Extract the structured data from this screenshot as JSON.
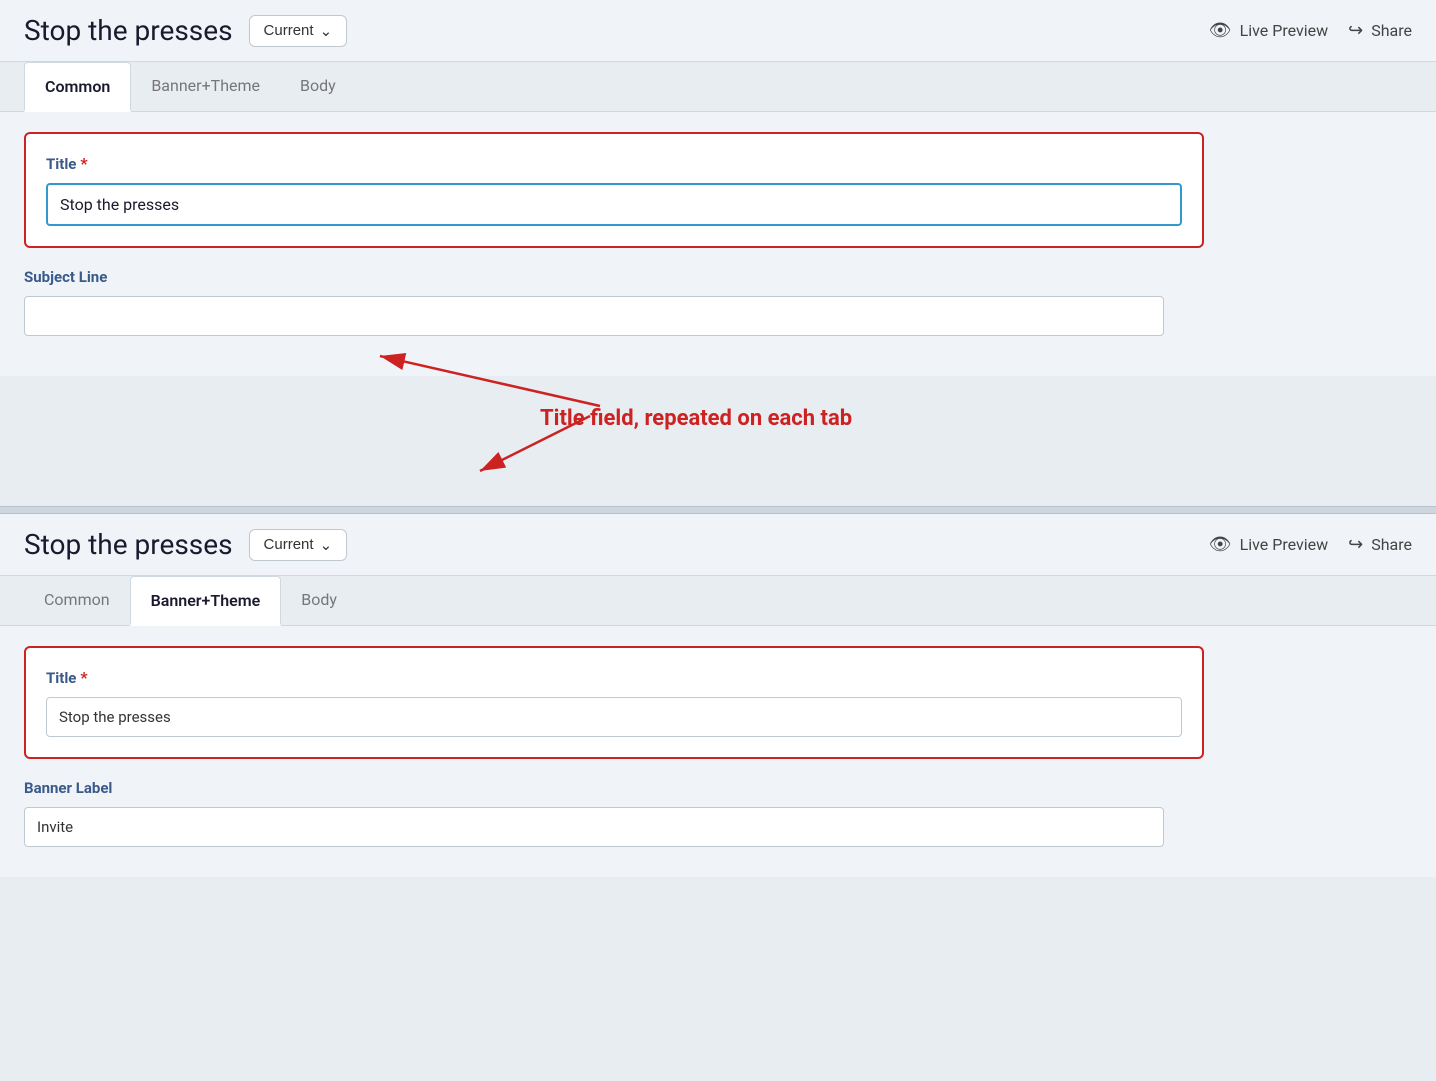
{
  "panels": [
    {
      "id": "panel1",
      "title": "Stop the presses",
      "version_label": "Current",
      "live_preview_label": "Live Preview",
      "share_label": "Share",
      "tabs": [
        {
          "id": "common",
          "label": "Common",
          "active": true
        },
        {
          "id": "banner_theme",
          "label": "Banner+Theme",
          "active": false
        },
        {
          "id": "body",
          "label": "Body",
          "active": false
        }
      ],
      "form": {
        "title_label": "Title",
        "title_required": true,
        "title_value": "Stop the presses",
        "title_placeholder": "",
        "subject_label": "Subject Line",
        "subject_value": "",
        "subject_placeholder": ""
      }
    },
    {
      "id": "panel2",
      "title": "Stop the presses",
      "version_label": "Current",
      "live_preview_label": "Live Preview",
      "share_label": "Share",
      "tabs": [
        {
          "id": "common",
          "label": "Common",
          "active": false
        },
        {
          "id": "banner_theme",
          "label": "Banner+Theme",
          "active": true
        },
        {
          "id": "body",
          "label": "Body",
          "active": false
        }
      ],
      "form": {
        "title_label": "Title",
        "title_required": true,
        "title_value": "Stop the presses",
        "title_placeholder": "",
        "banner_label": "Banner Label",
        "banner_value": "Invite",
        "banner_placeholder": ""
      }
    }
  ],
  "annotation": {
    "text": "Title field, repeated on each tab"
  },
  "icons": {
    "eye": "👁",
    "share": "↪",
    "chevron_down": "∨"
  }
}
